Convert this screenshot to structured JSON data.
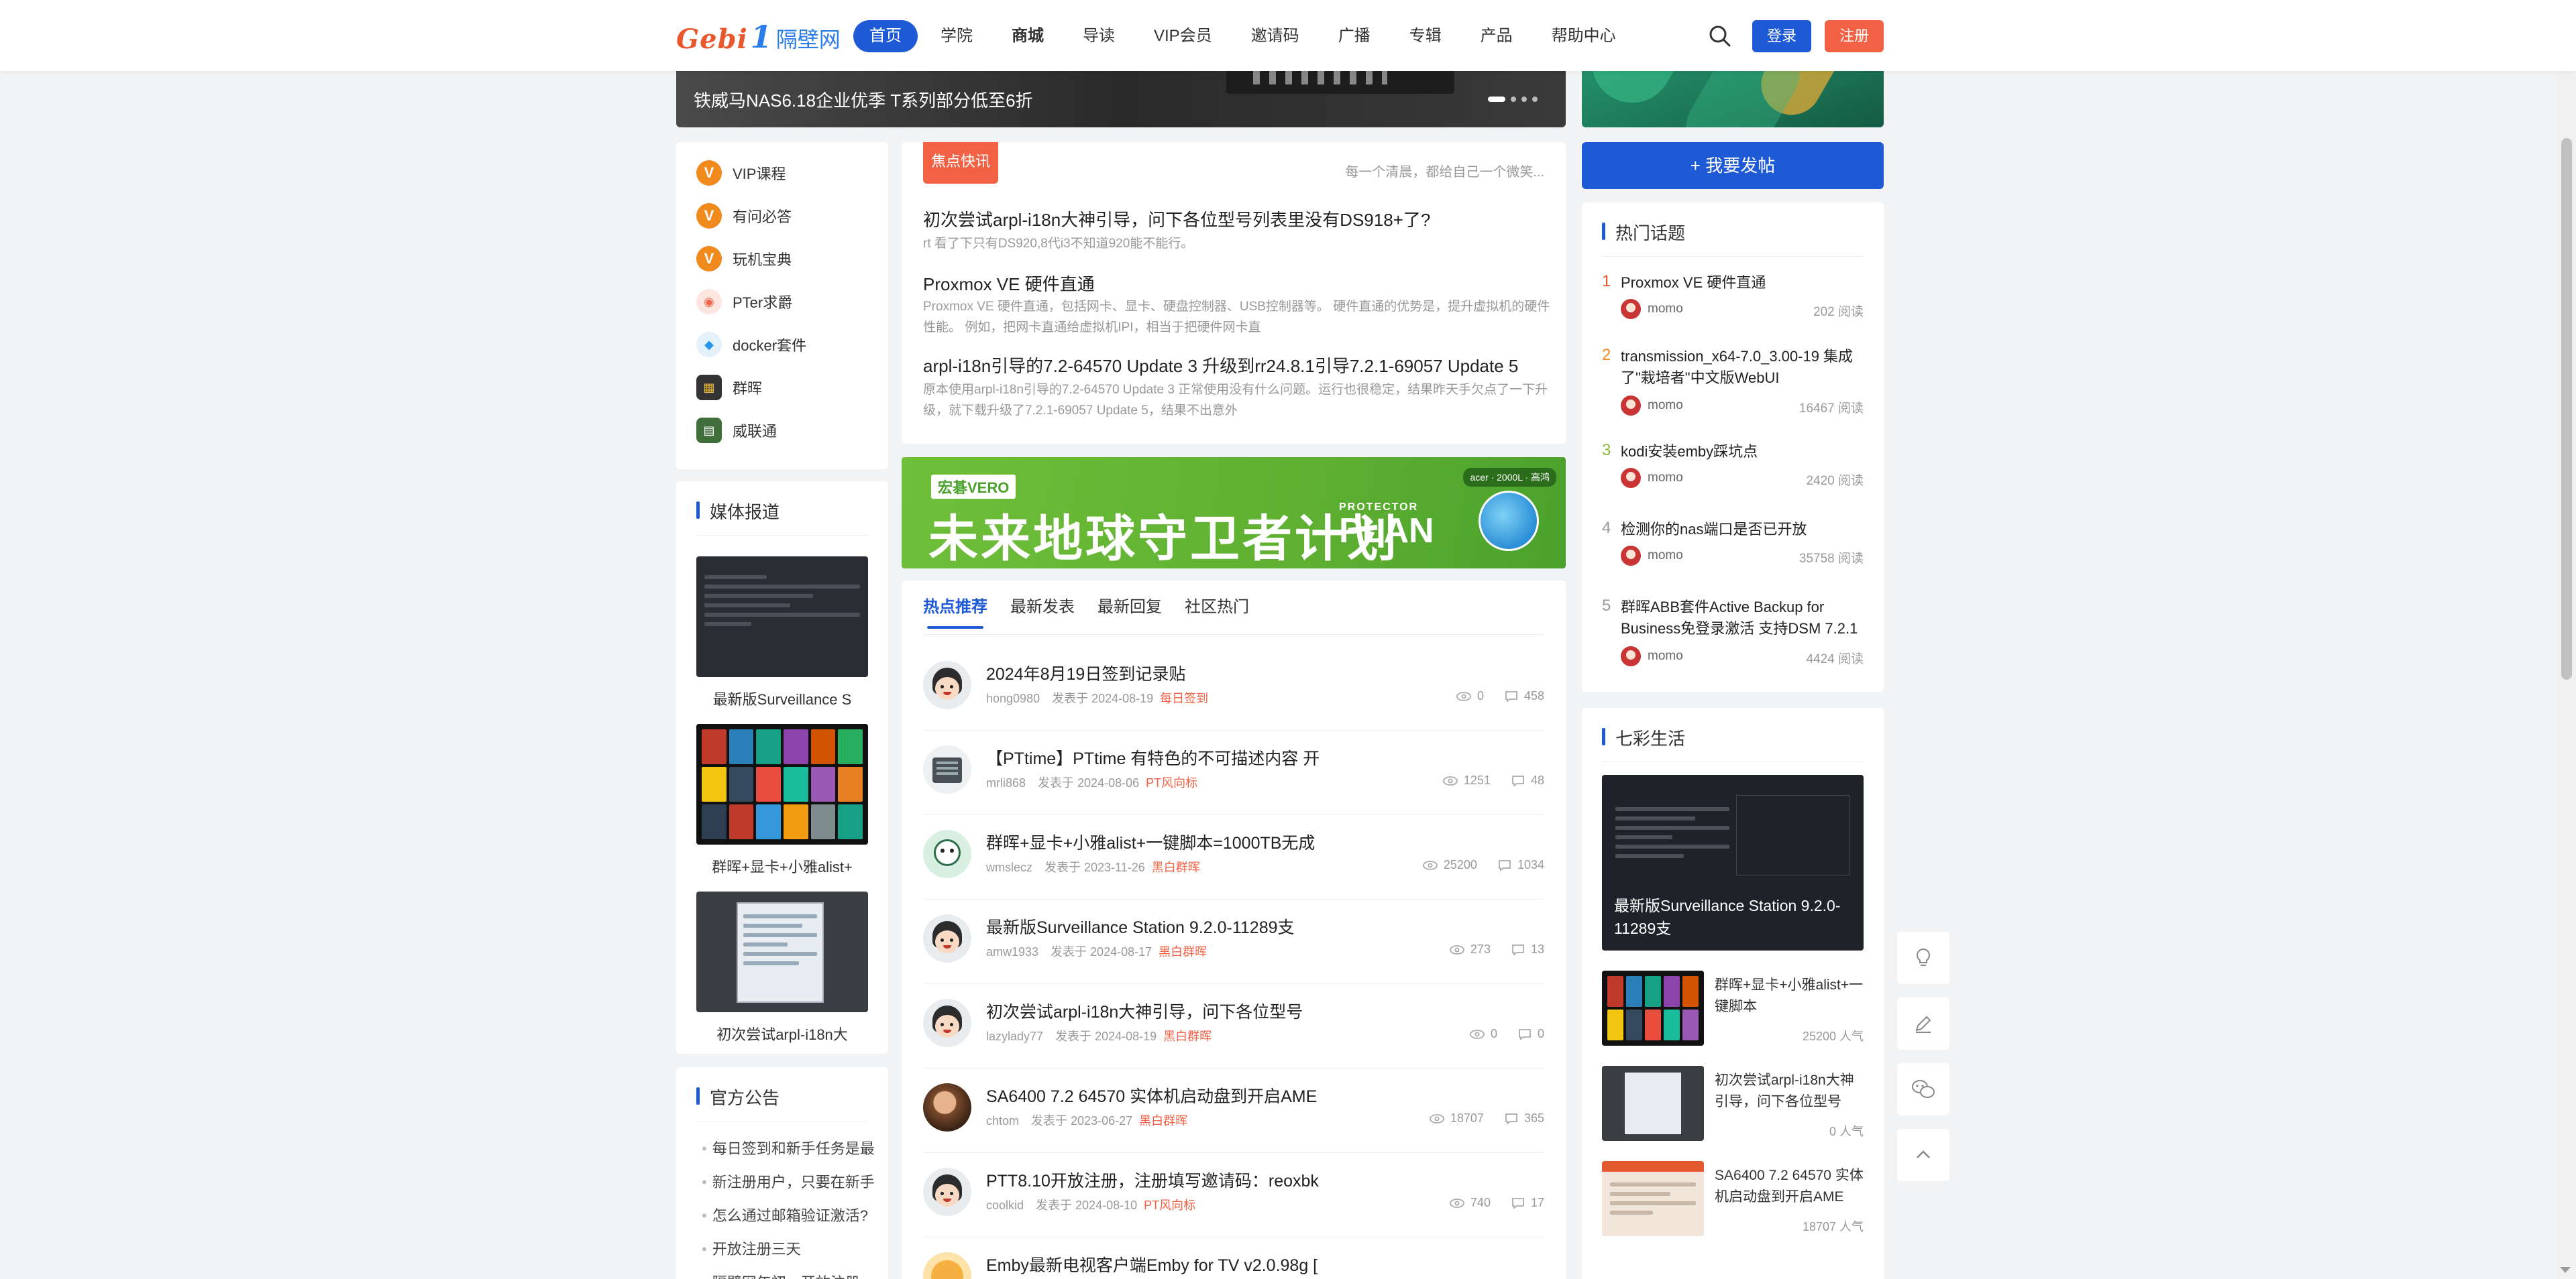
{
  "header": {
    "logo_main": "Gebi",
    "logo_num": "1",
    "logo_cn": "隔壁网",
    "nav": [
      "首页",
      "学院",
      "商城",
      "导读",
      "VIP会员",
      "邀请码",
      "广播",
      "专辑",
      "产品",
      "帮助中心"
    ],
    "login": "登录",
    "register": "注册"
  },
  "banner": {
    "caption": "铁威马NAS6.18企业优季 T系列部分低至6折"
  },
  "left_menu": [
    {
      "label": "VIP课程",
      "color": "#f08a1c",
      "glyph": "V"
    },
    {
      "label": "有问必答",
      "color": "#f08a1c",
      "glyph": "V"
    },
    {
      "label": "玩机宝典",
      "color": "#f08a1c",
      "glyph": "V"
    },
    {
      "label": "PTer求爵",
      "color": "#f26144",
      "glyph": "P"
    },
    {
      "label": "docker套件",
      "color": "#5aa7e0",
      "glyph": "D"
    },
    {
      "label": "群晖",
      "color": "#333333",
      "glyph": "S"
    },
    {
      "label": "威联通",
      "color": "#3f6e3a",
      "glyph": "Q"
    }
  ],
  "media": {
    "title": "媒体报道",
    "items": [
      "最新版Surveillance S",
      "群晖+显卡+小雅alist+",
      "初次尝试arpl-i18n大"
    ]
  },
  "notice": {
    "title": "官方公告",
    "items": [
      "每日签到和新手任务是最",
      "新注册用户，只要在新手",
      "怎么通过邮箱验证激活?",
      "开放注册三天",
      "隔壁网年初，开放注册"
    ]
  },
  "news": {
    "tag": "焦点快讯",
    "slogan": "每一个清晨，都给自己一个微笑...",
    "items": [
      {
        "title": "初次尝试arpl-i18n大神引导，问下各位型号列表里没有DS918+了?",
        "desc": "rt 看了下只有DS920,8代i3不知道920能不能行。"
      },
      {
        "title": "Proxmox VE 硬件直通",
        "desc": "Proxmox VE 硬件直通，包括网卡、显卡、硬盘控制器、USB控制器等。 硬件直通的优势是，提升虚拟机的硬件性能。 例如，把网卡直通给虚拟机IPI，相当于把硬件网卡直"
      },
      {
        "title": "arpl-i18n引导的7.2-64570 Update 3 升级到rr24.8.1引导7.2.1-69057 Update 5",
        "desc": "原本使用arpl-i18n引导的7.2-64570 Update 3 正常使用没有什么问题。运行也很稳定，结果昨天手欠点了一下升级，就下载升级了7.2.1-69057 Update 5，结果不出意外"
      }
    ]
  },
  "ad": {
    "badge": "宏碁VERO",
    "title": "未来地球守卫者计划",
    "plan_small": "PROTECTOR",
    "plan_big": "PLAN",
    "brands": "acer · 2000L · 高鸿"
  },
  "post_tabs": [
    "热点推荐",
    "最新发表",
    "最新回复",
    "社区热门"
  ],
  "posts": [
    {
      "title": "2024年8月19日签到记录贴",
      "user": "hong0980",
      "date": "发表于 2024-08-19",
      "cat": "每日签到",
      "views": "0",
      "replies": "458",
      "avatar": "face"
    },
    {
      "title": "【PTtime】PTtime 有特色的不可描述内容 开",
      "user": "mrli868",
      "date": "发表于 2024-08-06",
      "cat": "PT风向标",
      "views": "1251",
      "replies": "48",
      "avatar": "nas"
    },
    {
      "title": "群晖+显卡+小雅alist+一键脚本=1000TB无成",
      "user": "wmslecz",
      "date": "发表于 2023-11-26",
      "cat": "黑白群晖",
      "views": "25200",
      "replies": "1034",
      "avatar": "green"
    },
    {
      "title": "最新版Surveillance Station 9.2.0-11289支",
      "user": "amw1933",
      "date": "发表于 2024-08-17",
      "cat": "黑白群晖",
      "views": "273",
      "replies": "13",
      "avatar": "face"
    },
    {
      "title": "初次尝试arpl-i18n大神引导，问下各位型号",
      "user": "lazylady77",
      "date": "发表于 2024-08-19",
      "cat": "黑白群晖",
      "views": "0",
      "replies": "0",
      "avatar": "face"
    },
    {
      "title": "SA6400 7.2 64570 实体机启动盘到开启AME",
      "user": "chtom",
      "date": "发表于 2023-06-27",
      "cat": "黑白群晖",
      "views": "18707",
      "replies": "365",
      "avatar": "photo"
    },
    {
      "title": "PTT8.10开放注册，注册填写邀请码：reoxbk",
      "user": "coolkid",
      "date": "发表于 2024-08-10",
      "cat": "PT风向标",
      "views": "740",
      "replies": "17",
      "avatar": "face"
    },
    {
      "title": "Emby最新电视客户端Emby for TV v2.0.98g [",
      "user": "",
      "date": "",
      "cat": "",
      "views": "",
      "replies": "",
      "avatar": "cartoon"
    }
  ],
  "right": {
    "post_button": "+ 我要发帖",
    "hot_title": "热门话题",
    "hot": [
      {
        "num": "1",
        "title": "Proxmox VE 硬件直通",
        "user": "momo",
        "reads": "202 阅读"
      },
      {
        "num": "2",
        "title": "transmission_x64-7.0_3.00-19 集成了\"栽培者\"中文版WebUI",
        "user": "momo",
        "reads": "16467 阅读"
      },
      {
        "num": "3",
        "title": "kodi安装emby踩坑点",
        "user": "momo",
        "reads": "2420 阅读"
      },
      {
        "num": "4",
        "title": "检测你的nas端口是否已开放",
        "user": "momo",
        "reads": "35758 阅读"
      },
      {
        "num": "5",
        "title": "群晖ABB套件Active Backup for Business免登录激活 支持DSM 7.2.1",
        "user": "momo",
        "reads": "4424 阅读"
      }
    ],
    "life_title": "七彩生活",
    "life_big": "最新版Surveillance Station 9.2.0-11289支",
    "life": [
      {
        "title": "群晖+显卡+小雅alist+一键脚本",
        "views": "25200 人气"
      },
      {
        "title": "初次尝试arpl-i18n大神引导，问下各位型号",
        "views": "0 人气"
      },
      {
        "title": "SA6400 7.2 64570 实体机启动盘到开启AME",
        "views": "18707 人气"
      }
    ]
  },
  "colors": {
    "primary": "#1f5ad6",
    "accent": "#f26144",
    "rank": [
      "#e8582c",
      "#f08a1c",
      "#8cb63c",
      "#999999",
      "#999999"
    ]
  }
}
